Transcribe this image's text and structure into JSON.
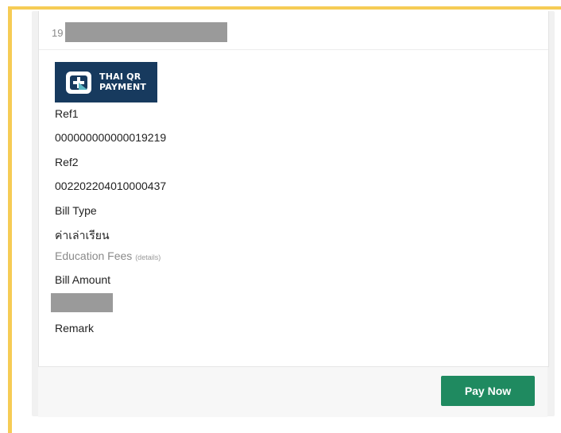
{
  "header": {
    "ref_prefix": "19"
  },
  "logo": {
    "line1": "THAI QR",
    "line2": "PAYMENT"
  },
  "fields": {
    "ref1_label": "Ref1",
    "ref1_value": "000000000000019219",
    "ref2_label": "Ref2",
    "ref2_value": "002202204010000437",
    "bill_type_label": "Bill Type",
    "bill_type_thai": "ค่าเล่าเรียน",
    "bill_type_en": "Education Fees",
    "details_link": "(details)",
    "bill_amount_label": "Bill Amount",
    "remark_label": "Remark"
  },
  "footer": {
    "pay_now_label": "Pay Now"
  },
  "colors": {
    "accent_frame": "#f6cc55",
    "pay_button": "#1f8a60",
    "logo_bg": "#173a5e"
  }
}
